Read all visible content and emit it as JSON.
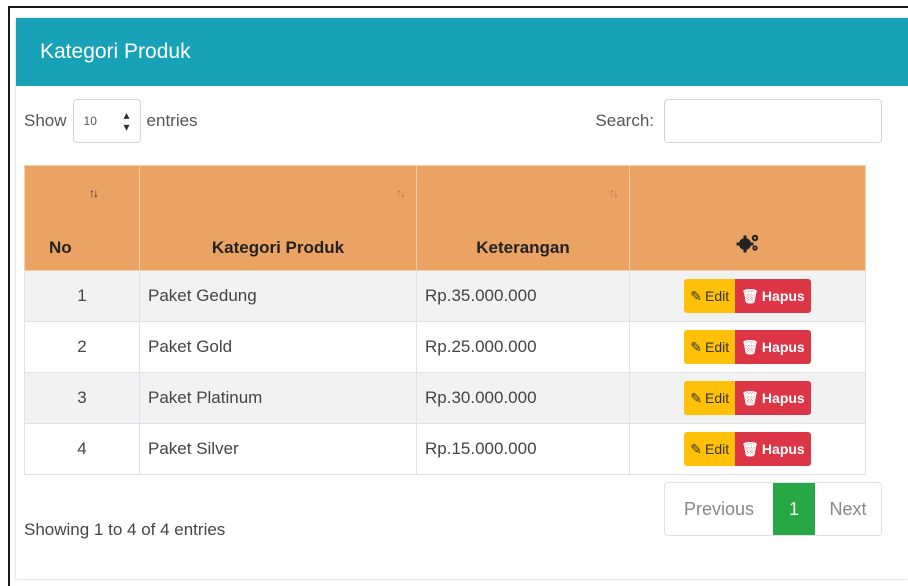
{
  "header": {
    "title": "Kategori Produk"
  },
  "length": {
    "show_label": "Show",
    "selected": "10",
    "entries_label": "entries"
  },
  "search": {
    "label": "Search:",
    "value": "",
    "placeholder": ""
  },
  "table": {
    "columns": [
      "No",
      "Kategori Produk",
      "Keterangan"
    ],
    "action_icon": "gears-icon",
    "rows": [
      {
        "no": "1",
        "kategori": "Paket Gedung",
        "keterangan": "Rp.35.000.000"
      },
      {
        "no": "2",
        "kategori": "Paket Gold",
        "keterangan": "Rp.25.000.000"
      },
      {
        "no": "3",
        "kategori": "Paket Platinum",
        "keterangan": "Rp.30.000.000"
      },
      {
        "no": "4",
        "kategori": "Paket Silver",
        "keterangan": "Rp.15.000.000"
      }
    ],
    "edit_label": "Edit",
    "delete_label": "Hapus"
  },
  "footer": {
    "info": "Showing 1 to 4 of 4 entries",
    "previous": "Previous",
    "current_page": "1",
    "next": "Next"
  },
  "colors": {
    "header": "#17a2b8",
    "table_header": "#eba364",
    "edit_button": "#ffc107",
    "delete_button": "#dc3545",
    "active_page": "#28a745"
  }
}
